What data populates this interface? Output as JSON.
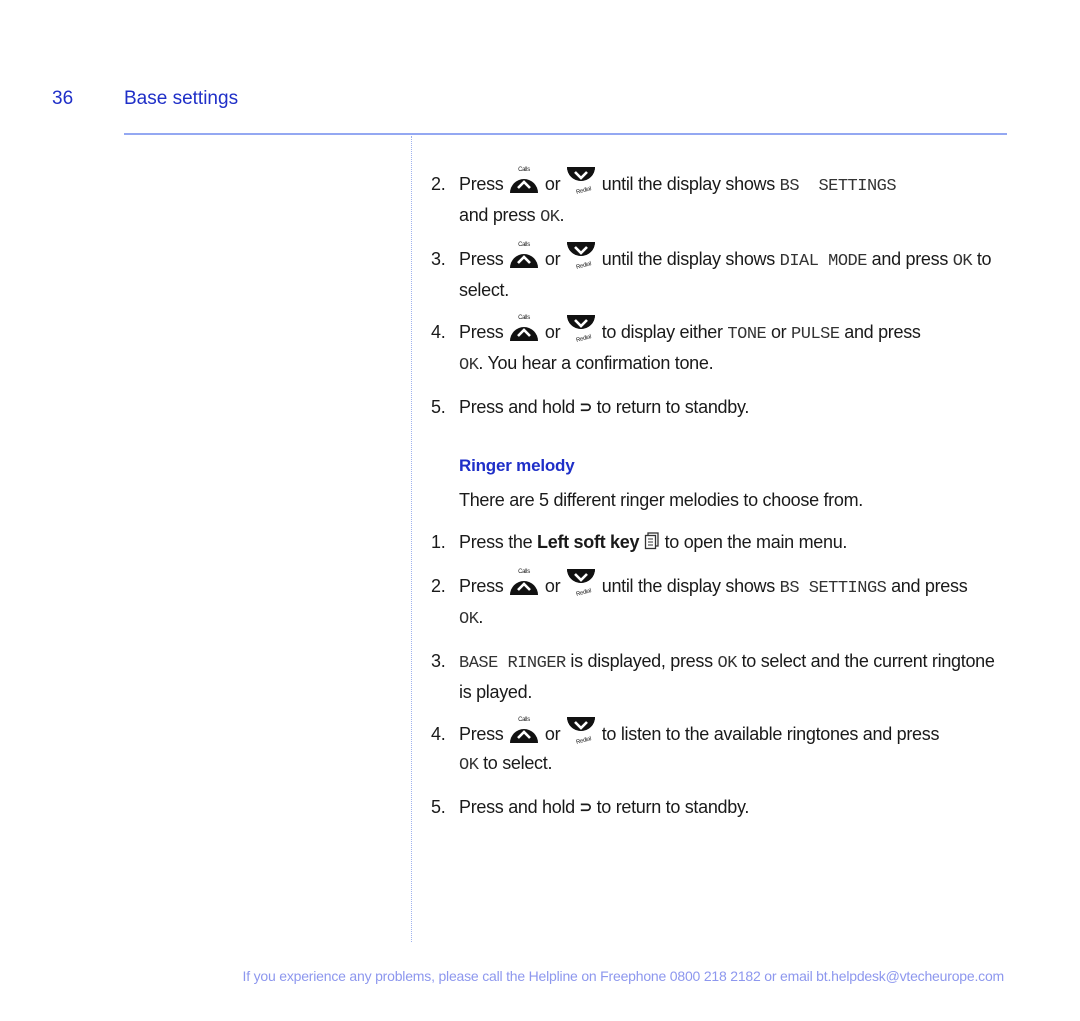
{
  "header": {
    "page_number": "36",
    "section_title": "Base settings"
  },
  "dial_mode_steps": [
    {
      "num": "2.",
      "pre": "Press",
      "or": "or",
      "post": "until the display shows",
      "lcd": "BS  SETTINGS",
      "post2": "and press",
      "lcd2": "OK",
      "end": "."
    },
    {
      "num": "3.",
      "pre": "Press",
      "or": "or",
      "post": "until the display shows",
      "lcd": "DIAL MODE",
      "post2": "and press",
      "lcd2": "OK",
      "end": "to select."
    },
    {
      "num": "4.",
      "pre": "Press",
      "or": "or",
      "post": "to display either",
      "lcd": "TONE",
      "mid": "or",
      "lcd_b": "PULSE",
      "post2": "and press",
      "lcd2": "OK",
      "end": ". You hear a confirmation tone."
    },
    {
      "num": "5.",
      "pre": "Press and hold",
      "end": "to return to standby."
    }
  ],
  "ringer": {
    "heading": "Ringer melody",
    "intro": "There are 5 different ringer melodies to choose from.",
    "step1": {
      "num": "1.",
      "pre": "Press the",
      "bold": "Left soft key",
      "end": "to open the main menu."
    },
    "step2": {
      "num": "2.",
      "pre": "Press",
      "or": "or",
      "post": "until the display shows",
      "lcd": "BS SETTINGS",
      "post2": "and press",
      "lcd2": "OK",
      "end": "."
    },
    "step3": {
      "num": "3.",
      "lcd": "BASE RINGER",
      "mid": "is displayed, press",
      "lcd2": "OK",
      "end": "to select and the current ringtone is played."
    },
    "step4": {
      "num": "4.",
      "pre": "Press",
      "or": "or",
      "post": "to listen to the available ringtones and press",
      "lcd2": "OK",
      "end": "to select."
    },
    "step5": {
      "num": "5.",
      "pre": "Press and hold",
      "end": "to return to standby."
    }
  },
  "icons": {
    "up_label": "Calls",
    "down_label": "Redial",
    "back_glyph": "⊃"
  },
  "footer": {
    "text": "If you experience any problems, please call the Helpline on Freephone 0800 218 2182 or email bt.helpdesk@vtecheurope.com"
  }
}
